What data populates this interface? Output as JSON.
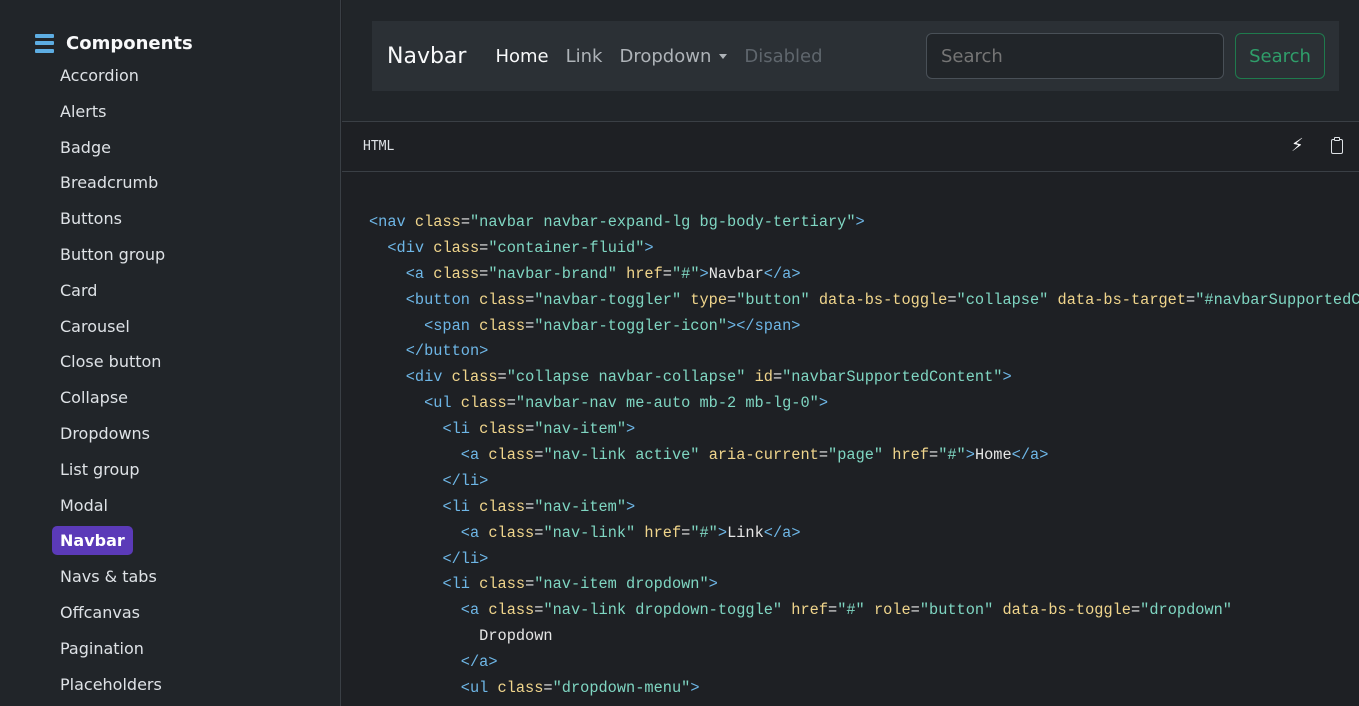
{
  "sidebar": {
    "title": "Components",
    "items": [
      "Accordion",
      "Alerts",
      "Badge",
      "Breadcrumb",
      "Buttons",
      "Button group",
      "Card",
      "Carousel",
      "Close button",
      "Collapse",
      "Dropdowns",
      "List group",
      "Modal",
      "Navbar",
      "Navs & tabs",
      "Offcanvas",
      "Pagination",
      "Placeholders"
    ],
    "active": "Navbar"
  },
  "preview": {
    "brand": "Navbar",
    "links": {
      "home": "Home",
      "link": "Link",
      "dropdown": "Dropdown",
      "disabled": "Disabled"
    },
    "search_placeholder": "Search",
    "search_button": "Search"
  },
  "code_panel": {
    "language": "HTML",
    "lines": [
      [
        [
          "tag",
          "<nav "
        ],
        [
          "attr",
          "class"
        ],
        [
          "txt",
          "="
        ],
        [
          "str",
          "\"navbar navbar-expand-lg bg-body-tertiary\""
        ],
        [
          "tag",
          ">"
        ]
      ],
      [
        [
          "txt",
          "  "
        ],
        [
          "tag",
          "<div "
        ],
        [
          "attr",
          "class"
        ],
        [
          "txt",
          "="
        ],
        [
          "str",
          "\"container-fluid\""
        ],
        [
          "tag",
          ">"
        ]
      ],
      [
        [
          "txt",
          "    "
        ],
        [
          "tag",
          "<a "
        ],
        [
          "attr",
          "class"
        ],
        [
          "txt",
          "="
        ],
        [
          "str",
          "\"navbar-brand\""
        ],
        [
          "txt",
          " "
        ],
        [
          "attr",
          "href"
        ],
        [
          "txt",
          "="
        ],
        [
          "str",
          "\"#\""
        ],
        [
          "tag",
          ">"
        ],
        [
          "txt",
          "Navbar"
        ],
        [
          "tag",
          "</a>"
        ]
      ],
      [
        [
          "txt",
          "    "
        ],
        [
          "tag",
          "<button "
        ],
        [
          "attr",
          "class"
        ],
        [
          "txt",
          "="
        ],
        [
          "str",
          "\"navbar-toggler\""
        ],
        [
          "txt",
          " "
        ],
        [
          "attr",
          "type"
        ],
        [
          "txt",
          "="
        ],
        [
          "str",
          "\"button\""
        ],
        [
          "txt",
          " "
        ],
        [
          "attr",
          "data-bs-toggle"
        ],
        [
          "txt",
          "="
        ],
        [
          "str",
          "\"collapse\""
        ],
        [
          "txt",
          " "
        ],
        [
          "attr",
          "data-bs-target"
        ],
        [
          "txt",
          "="
        ],
        [
          "str",
          "\"#navbarSupportedContent\""
        ]
      ],
      [
        [
          "txt",
          "      "
        ],
        [
          "tag",
          "<span "
        ],
        [
          "attr",
          "class"
        ],
        [
          "txt",
          "="
        ],
        [
          "str",
          "\"navbar-toggler-icon\""
        ],
        [
          "tag",
          "></span>"
        ]
      ],
      [
        [
          "txt",
          "    "
        ],
        [
          "tag",
          "</button>"
        ]
      ],
      [
        [
          "txt",
          "    "
        ],
        [
          "tag",
          "<div "
        ],
        [
          "attr",
          "class"
        ],
        [
          "txt",
          "="
        ],
        [
          "str",
          "\"collapse navbar-collapse\""
        ],
        [
          "txt",
          " "
        ],
        [
          "attr",
          "id"
        ],
        [
          "txt",
          "="
        ],
        [
          "str",
          "\"navbarSupportedContent\""
        ],
        [
          "tag",
          ">"
        ]
      ],
      [
        [
          "txt",
          "      "
        ],
        [
          "tag",
          "<ul "
        ],
        [
          "attr",
          "class"
        ],
        [
          "txt",
          "="
        ],
        [
          "str",
          "\"navbar-nav me-auto mb-2 mb-lg-0\""
        ],
        [
          "tag",
          ">"
        ]
      ],
      [
        [
          "txt",
          "        "
        ],
        [
          "tag",
          "<li "
        ],
        [
          "attr",
          "class"
        ],
        [
          "txt",
          "="
        ],
        [
          "str",
          "\"nav-item\""
        ],
        [
          "tag",
          ">"
        ]
      ],
      [
        [
          "txt",
          "          "
        ],
        [
          "tag",
          "<a "
        ],
        [
          "attr",
          "class"
        ],
        [
          "txt",
          "="
        ],
        [
          "str",
          "\"nav-link active\""
        ],
        [
          "txt",
          " "
        ],
        [
          "attr",
          "aria-current"
        ],
        [
          "txt",
          "="
        ],
        [
          "str",
          "\"page\""
        ],
        [
          "txt",
          " "
        ],
        [
          "attr",
          "href"
        ],
        [
          "txt",
          "="
        ],
        [
          "str",
          "\"#\""
        ],
        [
          "tag",
          ">"
        ],
        [
          "txt",
          "Home"
        ],
        [
          "tag",
          "</a>"
        ]
      ],
      [
        [
          "txt",
          "        "
        ],
        [
          "tag",
          "</li>"
        ]
      ],
      [
        [
          "txt",
          "        "
        ],
        [
          "tag",
          "<li "
        ],
        [
          "attr",
          "class"
        ],
        [
          "txt",
          "="
        ],
        [
          "str",
          "\"nav-item\""
        ],
        [
          "tag",
          ">"
        ]
      ],
      [
        [
          "txt",
          "          "
        ],
        [
          "tag",
          "<a "
        ],
        [
          "attr",
          "class"
        ],
        [
          "txt",
          "="
        ],
        [
          "str",
          "\"nav-link\""
        ],
        [
          "txt",
          " "
        ],
        [
          "attr",
          "href"
        ],
        [
          "txt",
          "="
        ],
        [
          "str",
          "\"#\""
        ],
        [
          "tag",
          ">"
        ],
        [
          "txt",
          "Link"
        ],
        [
          "tag",
          "</a>"
        ]
      ],
      [
        [
          "txt",
          "        "
        ],
        [
          "tag",
          "</li>"
        ]
      ],
      [
        [
          "txt",
          "        "
        ],
        [
          "tag",
          "<li "
        ],
        [
          "attr",
          "class"
        ],
        [
          "txt",
          "="
        ],
        [
          "str",
          "\"nav-item dropdown\""
        ],
        [
          "tag",
          ">"
        ]
      ],
      [
        [
          "txt",
          "          "
        ],
        [
          "tag",
          "<a "
        ],
        [
          "attr",
          "class"
        ],
        [
          "txt",
          "="
        ],
        [
          "str",
          "\"nav-link dropdown-toggle\""
        ],
        [
          "txt",
          " "
        ],
        [
          "attr",
          "href"
        ],
        [
          "txt",
          "="
        ],
        [
          "str",
          "\"#\""
        ],
        [
          "txt",
          " "
        ],
        [
          "attr",
          "role"
        ],
        [
          "txt",
          "="
        ],
        [
          "str",
          "\"button\""
        ],
        [
          "txt",
          " "
        ],
        [
          "attr",
          "data-bs-toggle"
        ],
        [
          "txt",
          "="
        ],
        [
          "str",
          "\"dropdown\""
        ]
      ],
      [
        [
          "txt",
          "            Dropdown"
        ]
      ],
      [
        [
          "txt",
          "          "
        ],
        [
          "tag",
          "</a>"
        ]
      ],
      [
        [
          "txt",
          "          "
        ],
        [
          "tag",
          "<ul "
        ],
        [
          "attr",
          "class"
        ],
        [
          "txt",
          "="
        ],
        [
          "str",
          "\"dropdown-menu\""
        ],
        [
          "tag",
          ">"
        ]
      ]
    ]
  }
}
